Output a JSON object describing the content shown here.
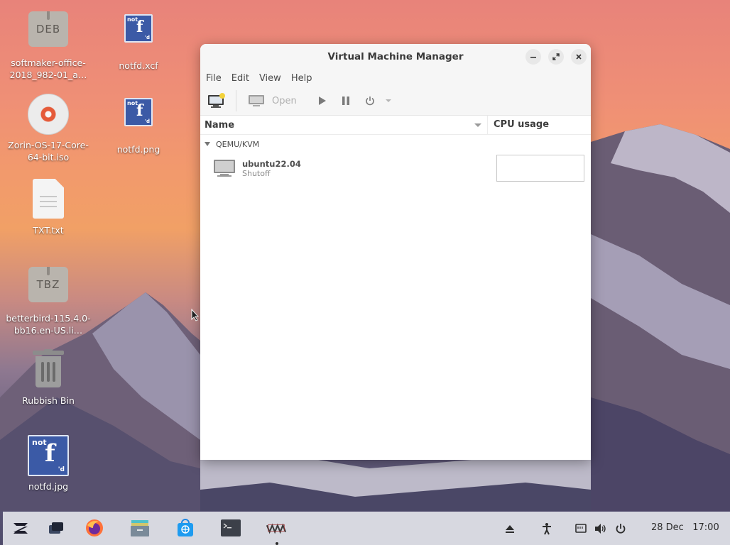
{
  "desktop": {
    "icons": [
      {
        "label": "softmaker-office-2018_982-01_a…",
        "type": "package",
        "badge": "DEB"
      },
      {
        "label": "notfd.xcf",
        "type": "image"
      },
      {
        "label": "Zorin-OS-17-Core-64-bit.iso",
        "type": "disc"
      },
      {
        "label": "notfd.png",
        "type": "image"
      },
      {
        "label": "TXT.txt",
        "type": "text"
      },
      {
        "label": "betterbird-115.4.0-bb16.en-US.li…",
        "type": "package",
        "badge": "TBZ"
      },
      {
        "label": "Rubbish Bin",
        "type": "trash"
      },
      {
        "label": "notfd.jpg",
        "type": "image"
      }
    ],
    "fb_logo": {
      "not": "not",
      "f": "f",
      "d": "'d"
    }
  },
  "window": {
    "title": "Virtual Machine Manager",
    "menu": [
      "File",
      "Edit",
      "View",
      "Help"
    ],
    "toolbar": {
      "open_label": "Open"
    },
    "columns": {
      "name": "Name",
      "cpu": "CPU usage"
    },
    "groups": [
      {
        "name": "QEMU/KVM",
        "vms": [
          {
            "name": "ubuntu22.04",
            "state": "Shutoff"
          }
        ]
      }
    ]
  },
  "taskbar": {
    "clock": {
      "date": "28 Dec",
      "time": "17:00"
    }
  },
  "colors": {
    "accent_blue": "#3b5aa6",
    "taskbar_bg": "#d7d8e0",
    "window_bg": "#ffffff",
    "chrome_bg": "#f6f6f6"
  }
}
